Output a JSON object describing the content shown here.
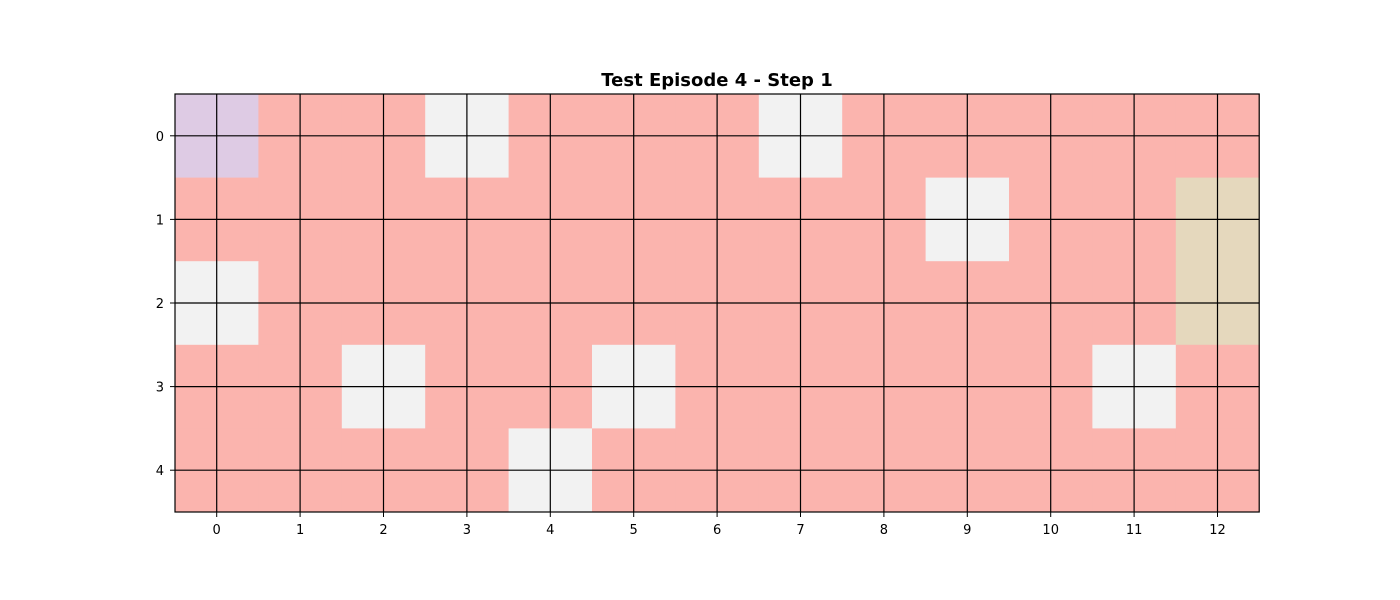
{
  "title": "Test Episode 4 - Step 1",
  "grid": {
    "rows": 5,
    "cols": 13,
    "x_ticks": [
      "0",
      "1",
      "2",
      "3",
      "4",
      "5",
      "6",
      "7",
      "8",
      "9",
      "10",
      "11",
      "12"
    ],
    "y_ticks": [
      "0",
      "1",
      "2",
      "3",
      "4"
    ],
    "show_grid_lines": true,
    "grid_line_color": "#000000"
  },
  "colors": {
    "cliff": "#fbb4ae",
    "safe": "#f2f2f2",
    "agent": "#decbe4",
    "goal": "#e5d8bd"
  },
  "cells": [
    [
      "agent",
      "cliff",
      "cliff",
      "safe",
      "cliff",
      "cliff",
      "cliff",
      "safe",
      "cliff",
      "cliff",
      "cliff",
      "cliff",
      "cliff"
    ],
    [
      "cliff",
      "cliff",
      "cliff",
      "cliff",
      "cliff",
      "cliff",
      "cliff",
      "cliff",
      "cliff",
      "safe",
      "cliff",
      "cliff",
      "goal"
    ],
    [
      "safe",
      "cliff",
      "cliff",
      "cliff",
      "cliff",
      "cliff",
      "cliff",
      "cliff",
      "cliff",
      "cliff",
      "cliff",
      "cliff",
      "goal"
    ],
    [
      "cliff",
      "cliff",
      "safe",
      "cliff",
      "cliff",
      "safe",
      "cliff",
      "cliff",
      "cliff",
      "cliff",
      "cliff",
      "safe",
      "cliff"
    ],
    [
      "cliff",
      "cliff",
      "cliff",
      "cliff",
      "safe",
      "cliff",
      "cliff",
      "cliff",
      "cliff",
      "cliff",
      "cliff",
      "cliff",
      "cliff"
    ]
  ]
}
